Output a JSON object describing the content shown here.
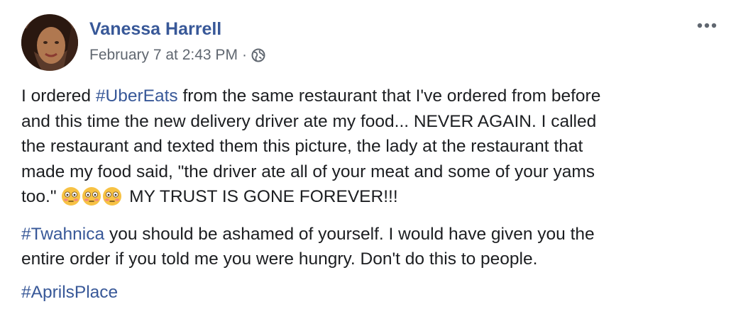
{
  "post": {
    "author": "Vanessa Harrell",
    "timestamp": "February 7 at 2:43 PM",
    "separator": "·",
    "privacy_icon": "globe-icon",
    "more_icon": "more-options-icon",
    "paragraphs": {
      "p1": {
        "line1_before": "I ordered ",
        "line1_hashtag": "#UberEats",
        "line1_after": " from the same restaurant that I've ordered from before",
        "line2": "and this time the new delivery driver ate my food... NEVER AGAIN. I called",
        "line3": "the restaurant and texted them this picture, the lady at the restaurant that",
        "line4": "made my food said, \"the driver ate all of your meat and some of your yams",
        "line5_before": "too.\" ",
        "emojis": [
          "flushed-face-emoji",
          "flushed-face-emoji",
          "flushed-face-emoji"
        ],
        "line5_after": " MY TRUST IS GONE FOREVER!!!"
      },
      "p2": {
        "hashtag": "#Twahnica",
        "line1_after": " you should be ashamed of yourself. I would have given you the",
        "line2": "entire order if you told me you were hungry. Don't do this to people."
      },
      "p3": {
        "hashtag": "#AprilsPlace"
      }
    },
    "colors": {
      "link": "#385898",
      "text": "#1c1e21",
      "meta": "#606770"
    }
  }
}
